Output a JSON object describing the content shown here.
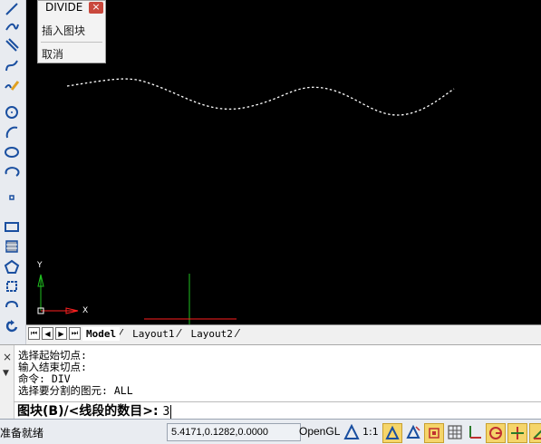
{
  "context_menu": {
    "title": "DIVIDE",
    "close": "×",
    "items": [
      "插入图块",
      "取消"
    ]
  },
  "tabs": {
    "model": "Model",
    "layout1": "Layout1",
    "layout2": "Layout2"
  },
  "ucs": {
    "x_label": "X",
    "y_label": "Y"
  },
  "command": {
    "history": [
      "选择起始切点:",
      "输入结束切点:",
      "命令: DIV",
      "选择要分割的图元: ALL"
    ],
    "prompt": "图块(B)/<线段的数目>:",
    "input_value": "3",
    "close": "×",
    "arrow": "▼"
  },
  "status": {
    "ready": "准备就绪",
    "coords": "5.4171,0.1282,0.0000",
    "opengl": "OpenGL",
    "scale": "1:1"
  },
  "colors": {
    "canvas": "#000000",
    "curve": "#ffffff",
    "ucs_axis": "#ff2020",
    "y_axis": "#20c020"
  }
}
